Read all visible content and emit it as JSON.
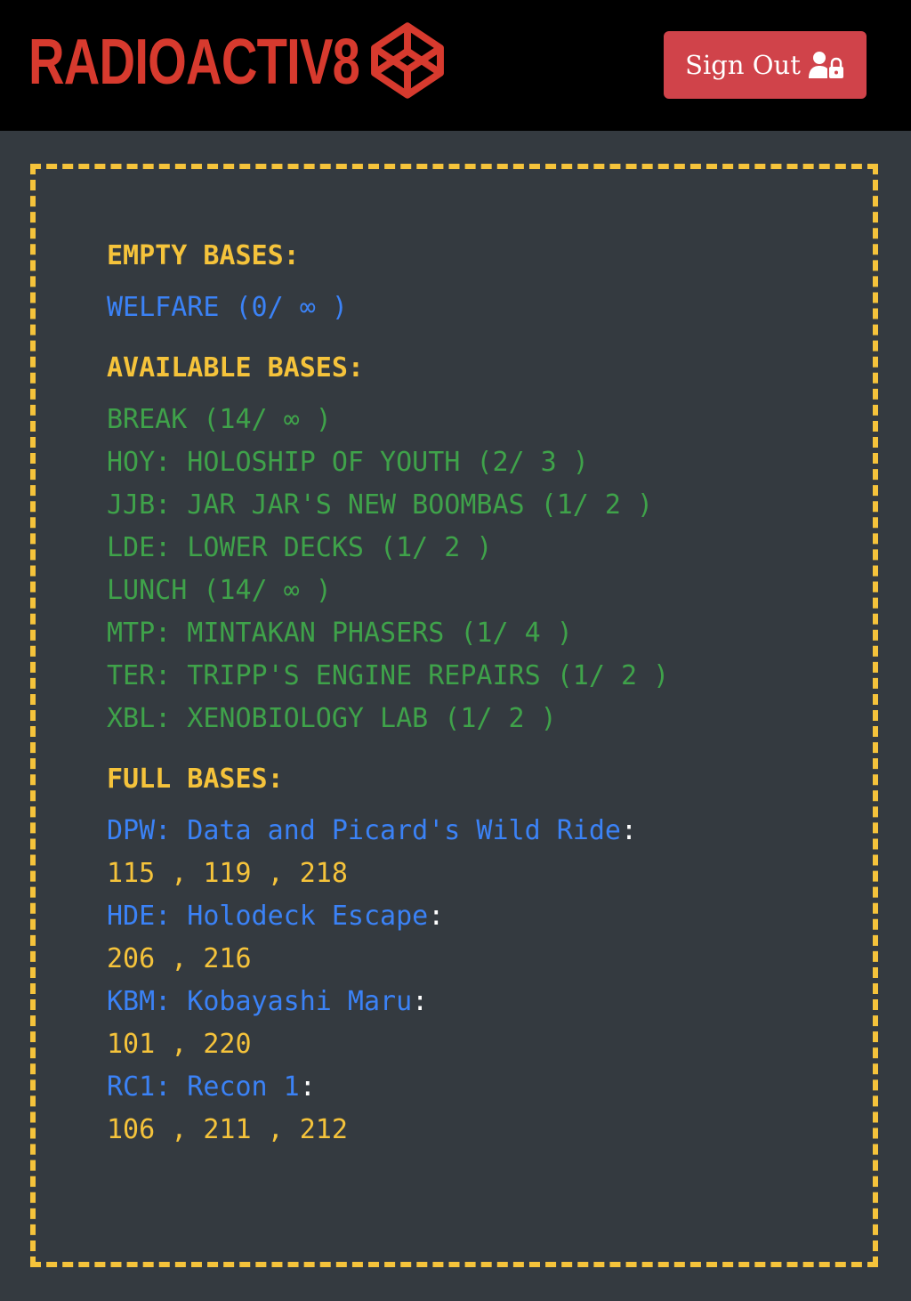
{
  "header": {
    "brand": "RADIOACTIV8",
    "signout_label": "Sign Out",
    "brand_icon": "codepen-cube-icon",
    "signout_icon": "user-lock-icon"
  },
  "colors": {
    "accent_red": "#d73a2e",
    "button_red": "#d0434a",
    "yellow": "#f5c33b",
    "blue": "#3b82f6",
    "green": "#3fa24a",
    "background": "#343a40"
  },
  "empty": {
    "title": "EMPTY BASES:",
    "items": [
      "WELFARE (0/ ∞ )"
    ]
  },
  "available": {
    "title": "AVAILABLE BASES:",
    "items": [
      "BREAK (14/ ∞ )",
      "HOY: HOLOSHIP OF YOUTH (2/ 3 )",
      "JJB: JAR JAR'S NEW BOOMBAS (1/ 2 )",
      "LDE: LOWER DECKS (1/ 2 )",
      "LUNCH (14/ ∞ )",
      "MTP: MINTAKAN PHASERS (1/ 4 )",
      "TER: TRIPP'S ENGINE REPAIRS (1/ 2 )",
      "XBL: XENOBIOLOGY LAB (1/ 2 )"
    ]
  },
  "full": {
    "title": "FULL BASES:",
    "items": [
      {
        "name": "DPW: Data and Picard's Wild Ride",
        "colon": ":",
        "values": "115 , 119 , 218"
      },
      {
        "name": "HDE: Holodeck Escape",
        "colon": ":",
        "values": "206 , 216"
      },
      {
        "name": "KBM: Kobayashi Maru",
        "colon": ":",
        "values": "101 , 220"
      },
      {
        "name": "RC1: Recon 1",
        "colon": ":",
        "values": "106 , 211 , 212"
      }
    ]
  }
}
